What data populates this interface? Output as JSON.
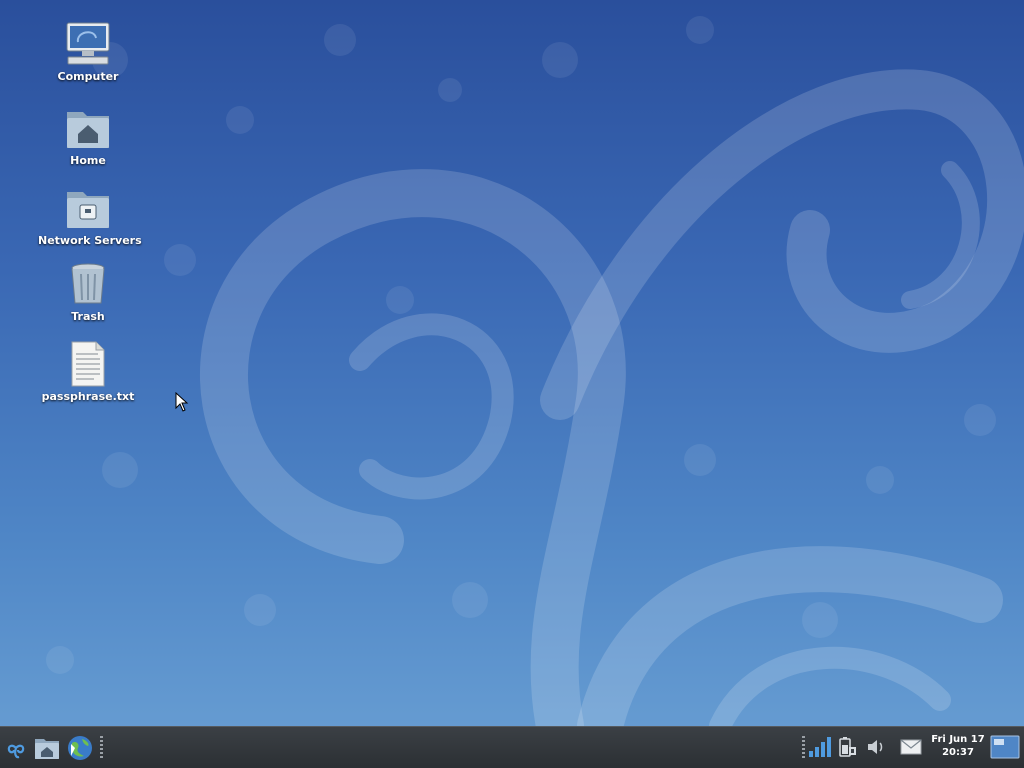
{
  "desktop": {
    "icons": [
      {
        "label": "Computer",
        "icon": "computer-icon"
      },
      {
        "label": "Home",
        "icon": "home-folder-icon"
      },
      {
        "label": "Network Servers",
        "icon": "network-folder-icon"
      },
      {
        "label": "Trash",
        "icon": "trash-icon"
      },
      {
        "label": "passphrase.txt",
        "icon": "text-file-icon"
      }
    ]
  },
  "taskbar": {
    "launchers": [
      {
        "icon": "applications-menu-icon"
      },
      {
        "icon": "home-folder-icon"
      },
      {
        "icon": "web-browser-icon"
      }
    ],
    "tray": [
      {
        "icon": "network-signal-icon"
      },
      {
        "icon": "battery-icon"
      },
      {
        "icon": "volume-icon"
      },
      {
        "icon": "mail-icon"
      }
    ],
    "clock": {
      "date": "Fri Jun 17",
      "time": "20:37"
    }
  },
  "colors": {
    "wallpaper_top": "#2a4f9c",
    "wallpaper_bottom": "#6aa0d4",
    "taskbar": "#2b2f33"
  }
}
